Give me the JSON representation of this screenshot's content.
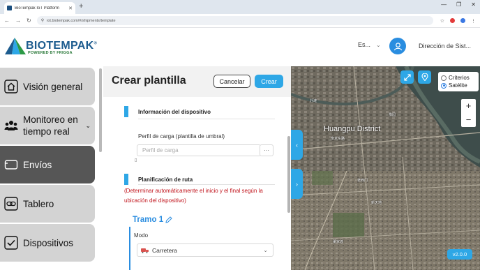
{
  "browser": {
    "tab_title": "BioTempak IoT Platform",
    "tab_close": "✕",
    "new_tab": "+",
    "min_icon": "—",
    "max_icon": "❐",
    "close_icon": "✕",
    "url": "iot.biotempak.com/#/shipments/template",
    "back": "←",
    "forward": "→",
    "reload": "↻",
    "ext_colors": [
      "#e33b3b",
      "#3b78e3"
    ]
  },
  "header": {
    "brand": "BIOTEMPAK",
    "reg": "®",
    "tagline": "POWERED BY FRIGGA",
    "language": "Es...",
    "user_name": "Dirección de Sist..."
  },
  "sidebar": {
    "items": [
      {
        "label": "Visión general",
        "icon": "home-icon"
      },
      {
        "label": "Monitoreo en tiempo real",
        "icon": "people-icon",
        "chevron": "⌄"
      },
      {
        "label": "Envíos",
        "icon": "box-icon",
        "active": true
      },
      {
        "label": "Tablero",
        "icon": "link-icon"
      },
      {
        "label": "Dispositivos",
        "icon": "check-icon"
      }
    ]
  },
  "form": {
    "title": "Crear plantilla",
    "cancel_label": "Cancelar",
    "create_label": "Crear",
    "device_section": "Información del dispositivo",
    "load_profile_label": "Perfil de carga (plantilla de umbral)",
    "load_profile_placeholder": "Perfil de carga",
    "ellipsis": "···",
    "route_section": "Planificación de ruta",
    "route_note": "(Determinar automáticamente el inicio y el final según la ubicación del dispositivo)",
    "segment_label": "Tramo 1",
    "mode_label": "Modo",
    "mode_value": "Carretera"
  },
  "map": {
    "layer_options": [
      "Criterios",
      "Satélite"
    ],
    "selected_layer": "Satélite",
    "district": "Huangpu District",
    "zoom_in": "+",
    "zoom_out": "−",
    "collapse_arrow": "‹",
    "expand_arrow": "›",
    "version": "v2.0.0",
    "place_labels": [
      "外滩",
      "豫园",
      "南京东路",
      "老西门",
      "新天地",
      "董家渡"
    ]
  },
  "colors": {
    "accent": "#2ea7e6",
    "brand": "#1d5c8f",
    "sidebar_active": "#565656",
    "sidebar_item": "#d3d3d3",
    "note_red": "#c0121a"
  }
}
